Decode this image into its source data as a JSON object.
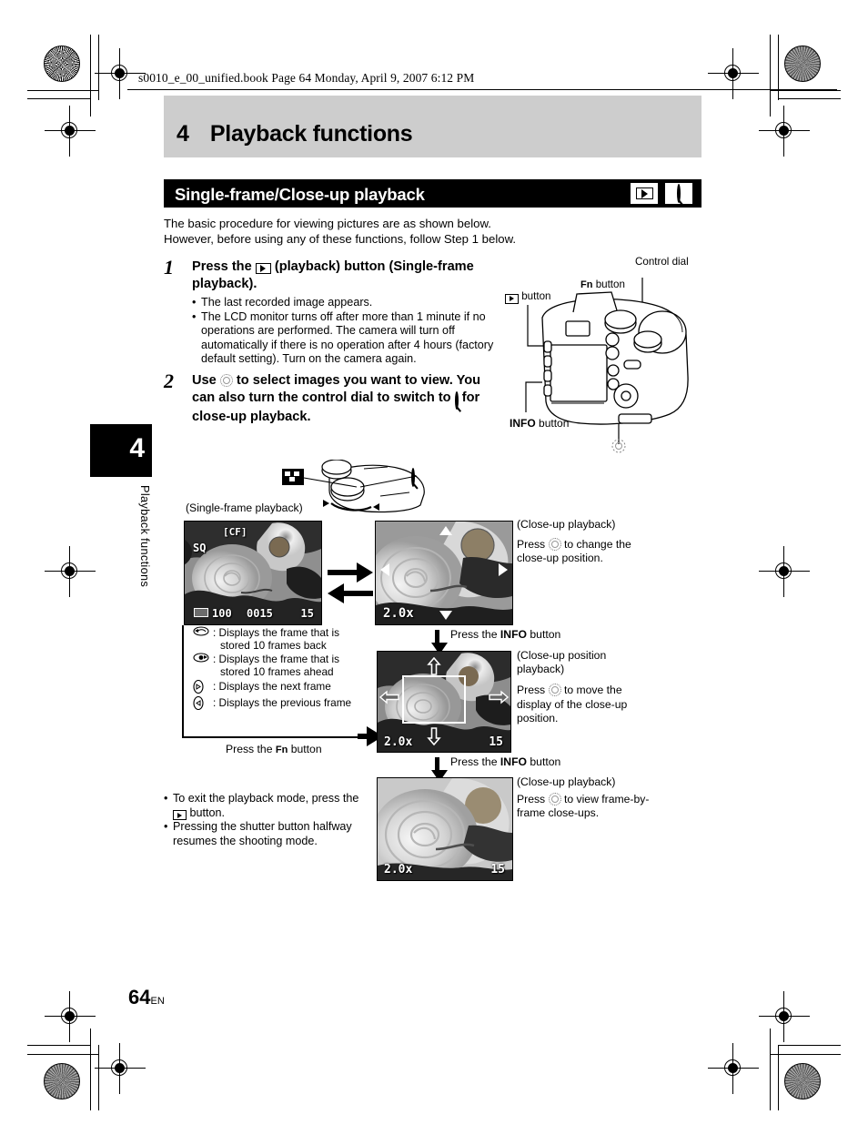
{
  "page": {
    "file_header": "s0010_e_00_unified.book  Page 64  Monday, April 9, 2007  6:12 PM",
    "chapter_number": "4",
    "chapter_title": "Playback functions",
    "chapter_tab_number": "4",
    "chapter_tab_text": "Playback functions",
    "page_number": "64",
    "page_lang": "EN"
  },
  "section": {
    "title": "Single-frame/Close-up playback",
    "icon1": "playback-icon",
    "icon2": "magnifier-icon",
    "intro_line1": "The basic procedure for viewing pictures are as shown below.",
    "intro_line2": "However, before using any of these functions, follow Step 1 below."
  },
  "steps": [
    {
      "number": "1",
      "heading_pre": "Press the",
      "heading_post": "(playback) button (Single-frame playback).",
      "bullets": [
        "The last recorded image appears.",
        "The LCD monitor turns off after more than 1 minute if no operations are performed. The camera will turn off automatically if there is no operation after 4 hours (factory default setting). Turn on the camera again."
      ]
    },
    {
      "number": "2",
      "heading_a": "Use",
      "heading_b": "to select images you want to view. You can also turn the control dial to switch to",
      "heading_c": "for close-up playback."
    }
  ],
  "camera_diagram": {
    "label_control_dial": "Control dial",
    "label_fn_button": "button",
    "label_fn_bold": "Fn",
    "label_playback_button": "button",
    "label_info_button": "button",
    "label_info_bold": "INFO"
  },
  "flow": {
    "single_frame_caption": "(Single-frame playback)",
    "lcd_single": {
      "card": "[CF]",
      "quality": "SQ",
      "folder": "100",
      "file": "0015",
      "frame": "15"
    },
    "lcd_closeup_1": {
      "zoom": "2.0x"
    },
    "lcd_closeup_pos": {
      "zoom": "2.0x",
      "frame": "15"
    },
    "lcd_closeup_2": {
      "zoom": "2.0x",
      "frame": "15"
    },
    "legend": [
      {
        "icon": "jump-back-10-icon",
        "text_line1": ": Displays the frame that is",
        "text_line2": "stored 10 frames back"
      },
      {
        "icon": "jump-ahead-10-icon",
        "text_line1": ": Displays the frame that is",
        "text_line2": "stored 10 frames ahead"
      },
      {
        "icon": "next-frame-icon",
        "text_line1": ": Displays the next frame",
        "text_line2": ""
      },
      {
        "icon": "previous-frame-icon",
        "text_line1": ": Displays the previous frame",
        "text_line2": ""
      }
    ],
    "press_fn_pre": "Press the",
    "press_fn_bold": "Fn",
    "press_fn_post": "button",
    "press_info_pre": "Press the",
    "press_info_bold": "INFO",
    "press_info_post": "button",
    "panel_closeup_1": {
      "caption": "(Close-up playback)",
      "text_a": "Press",
      "text_b": "to change the close-up position."
    },
    "panel_closeup_pos": {
      "caption": "(Close-up position playback)",
      "text_a": "Press",
      "text_b": "to move the display of the close-up position."
    },
    "panel_closeup_2": {
      "caption": "(Close-up playback)",
      "text_a": "Press",
      "text_b": "to view frame-by-frame close-ups."
    }
  },
  "footer_bullets": [
    {
      "pre": "To exit the playback mode, press the",
      "post": "button."
    },
    {
      "pre": "Pressing the shutter button halfway resumes the shooting mode.",
      "post": ""
    }
  ]
}
